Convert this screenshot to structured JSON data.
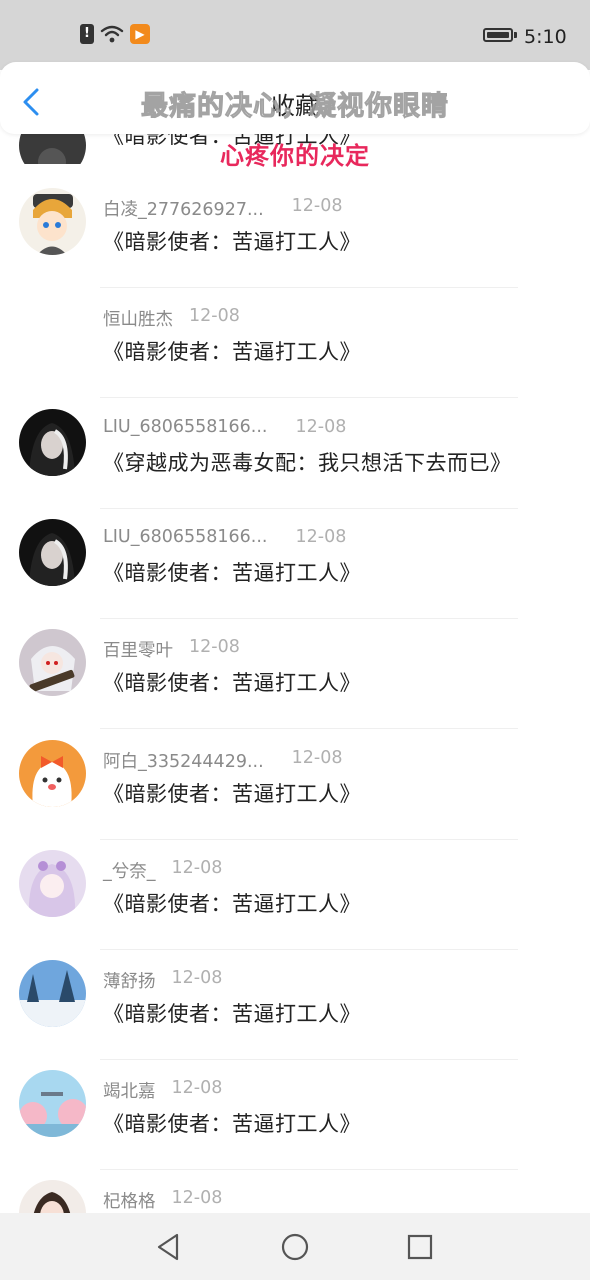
{
  "status_bar": {
    "time": "5:10",
    "battery_level": 1.0
  },
  "header": {
    "title": "收藏"
  },
  "overlay": {
    "line1": "最痛的决心，凝视你眼睛",
    "line2": "心疼你的决定"
  },
  "partial_row": {
    "title": "《暗影使者：苦逼打工人》"
  },
  "items": [
    {
      "name": "白凌_277626927...",
      "date": "12-08",
      "title": "《暗影使者：苦逼打工人》"
    },
    {
      "name": "恒山胜杰",
      "date": "12-08",
      "title": "《暗影使者：苦逼打工人》"
    },
    {
      "name": "LIU_6806558166...",
      "date": "12-08",
      "title": "《穿越成为恶毒女配：我只想活下去而已》"
    },
    {
      "name": "LIU_6806558166...",
      "date": "12-08",
      "title": "《暗影使者：苦逼打工人》"
    },
    {
      "name": "百里零叶",
      "date": "12-08",
      "title": "《暗影使者：苦逼打工人》"
    },
    {
      "name": "阿白_335244429...",
      "date": "12-08",
      "title": "《暗影使者：苦逼打工人》"
    },
    {
      "name": "_兮奈_",
      "date": "12-08",
      "title": "《暗影使者：苦逼打工人》"
    },
    {
      "name": "薄舒扬",
      "date": "12-08",
      "title": "《暗影使者：苦逼打工人》"
    },
    {
      "name": "竭北嘉",
      "date": "12-08",
      "title": "《暗影使者：苦逼打工人》"
    },
    {
      "name": "杞格格",
      "date": "12-08",
      "title": ""
    }
  ],
  "colors": {
    "accent": "#2c8ef0",
    "overlay_red": "#e8285c"
  }
}
